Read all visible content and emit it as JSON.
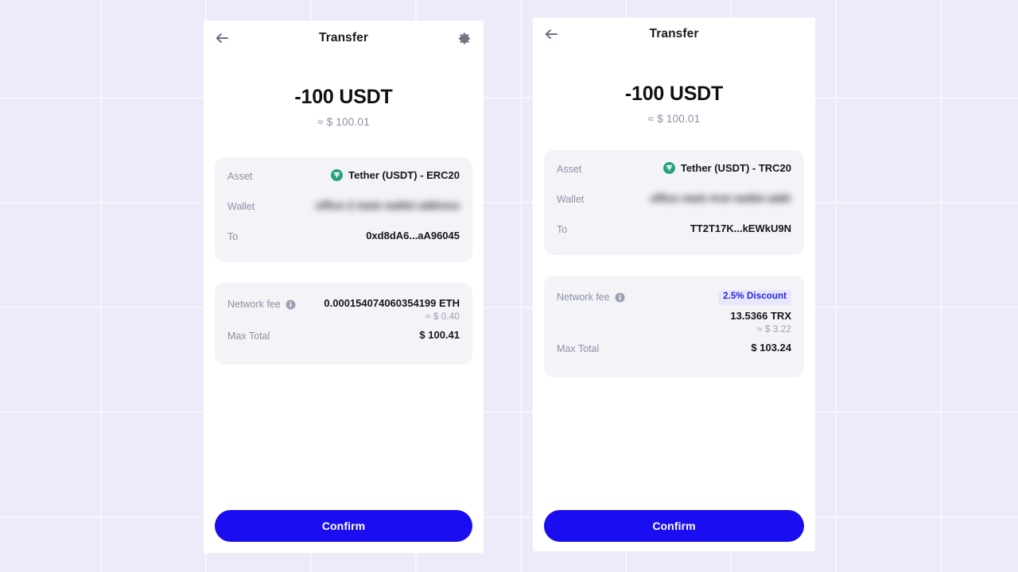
{
  "background": {
    "color": "#ebebfa",
    "grid_line_color": "#f6f6fd"
  },
  "theme": {
    "accent_blue": "#1a0ef0",
    "badge_bg": "#e7e7fb",
    "badge_text": "#2424e6",
    "card_bg": "#f4f4f8",
    "label_gray": "#8b8fa3",
    "tether_green": "#26a17b"
  },
  "panels": [
    {
      "id": "erc20",
      "header": {
        "title": "Transfer",
        "back_icon": "back-arrow-icon",
        "gear_icon": "gear-icon",
        "has_gear": true
      },
      "amount": {
        "main": "-100 USDT",
        "sub": "≈ $ 100.01"
      },
      "asset_card": {
        "rows": [
          {
            "label": "Asset",
            "value": "Tether (USDT) - ERC20",
            "icon": "tether-token-icon"
          },
          {
            "label": "Wallet",
            "value": "office 2 main wallet address",
            "redacted": true
          },
          {
            "label": "To",
            "value": "0xd8dA6...aA96045"
          }
        ]
      },
      "fee_card": {
        "fee_label": "Network fee",
        "fee_info_icon": "info-icon",
        "fee_value": "0.000154074060354199 ETH",
        "fee_sub": "≈ $ 0.40",
        "has_discount": false,
        "discount_badge": "",
        "total_label": "Max Total",
        "total_value": "$ 100.41"
      },
      "confirm_label": "Confirm"
    },
    {
      "id": "trc20",
      "header": {
        "title": "Transfer",
        "back_icon": "back-arrow-icon",
        "gear_icon": "",
        "has_gear": false
      },
      "amount": {
        "main": "-100 USDT",
        "sub": "≈ $ 100.01"
      },
      "asset_card": {
        "rows": [
          {
            "label": "Asset",
            "value": "Tether (USDT) - TRC20",
            "icon": "tether-token-icon"
          },
          {
            "label": "Wallet",
            "value": "office main tron wallet addr",
            "redacted": true
          },
          {
            "label": "To",
            "value": "TT2T17K...kEWkU9N"
          }
        ]
      },
      "fee_card": {
        "fee_label": "Network fee",
        "fee_info_icon": "info-icon",
        "fee_value": "13.5366 TRX",
        "fee_sub": "≈ $ 3.22",
        "has_discount": true,
        "discount_badge": "2.5% Discount",
        "total_label": "Max Total",
        "total_value": "$ 103.24"
      },
      "confirm_label": "Confirm"
    }
  ]
}
